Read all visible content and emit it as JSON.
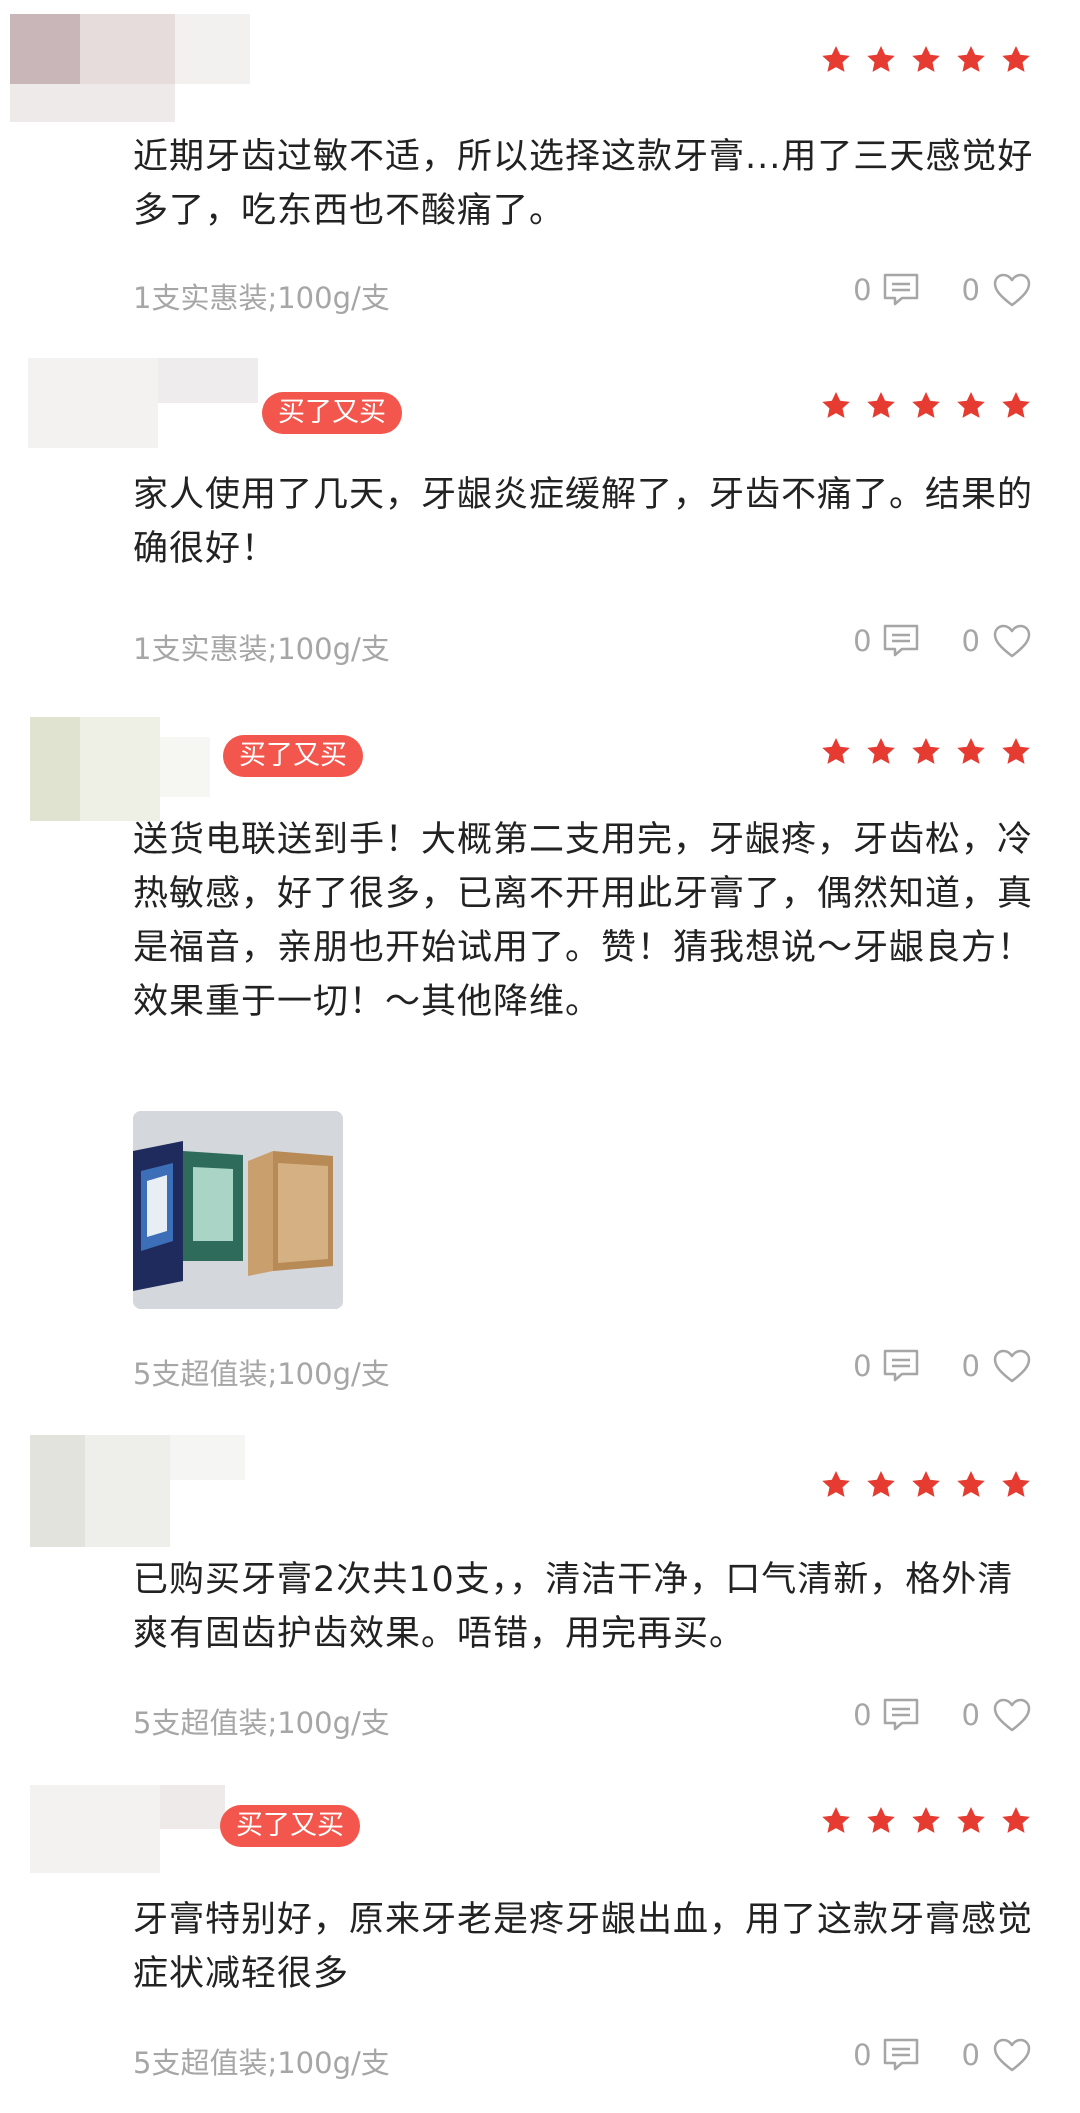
{
  "colors": {
    "star": "#e53b31",
    "badge": "#f2564c",
    "meta_gray": "#a6a6a6"
  },
  "reviews": [
    {
      "rating": 5,
      "text": "近期牙齿过敏不适，所以选择这款牙膏...用了三天感觉好多了，吃东西也不酸痛了。",
      "spec": "1支实惠装;100g/支",
      "comment_count": "0",
      "like_count": "0"
    },
    {
      "badge": "买了又买",
      "rating": 5,
      "text": "家人使用了几天，牙龈炎症缓解了，牙齿不痛了。结果的确很好！",
      "spec": "1支实惠装;100g/支",
      "comment_count": "0",
      "like_count": "0"
    },
    {
      "badge": "买了又买",
      "rating": 5,
      "text": "送货电联送到手！大概第二支用完，牙龈疼，牙齿松，冷热敏感，好了很多，已离不开用此牙膏了，偶然知道，真是福音，亲朋也开始试用了。赞！猜我想说～牙龈良方！效果重于一切！～其他降维。",
      "spec": "5支超值装;100g/支",
      "comment_count": "0",
      "like_count": "0"
    },
    {
      "rating": 5,
      "text": "已购买牙膏2次共10支，，清洁干净，口气清新，格外清爽有固齿护齿效果。唔错，用完再买。",
      "spec": "5支超值装;100g/支",
      "comment_count": "0",
      "like_count": "0"
    },
    {
      "badge": "买了又买",
      "rating": 5,
      "text": "牙膏特别好，原来牙老是疼牙龈出血，用了这款牙膏感觉症状减轻很多",
      "spec": "5支超值装;100g/支",
      "comment_count": "0",
      "like_count": "0"
    }
  ]
}
